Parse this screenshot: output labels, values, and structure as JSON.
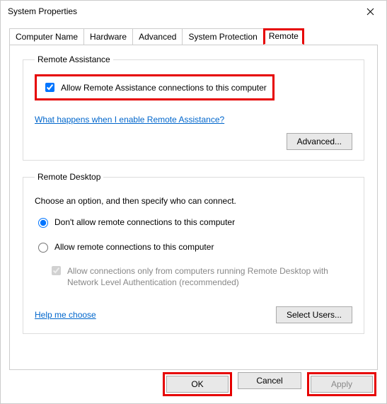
{
  "window": {
    "title": "System Properties"
  },
  "tabs": {
    "computer_name": "Computer Name",
    "hardware": "Hardware",
    "advanced": "Advanced",
    "system_protection": "System Protection",
    "remote": "Remote"
  },
  "remote_assistance": {
    "legend": "Remote Assistance",
    "allow_label": "Allow Remote Assistance connections to this computer",
    "allow_checked": true,
    "help_link": "What happens when I enable Remote Assistance?",
    "advanced_button": "Advanced..."
  },
  "remote_desktop": {
    "legend": "Remote Desktop",
    "instruction": "Choose an option, and then specify who can connect.",
    "option_deny": "Don't allow remote connections to this computer",
    "option_allow": "Allow remote connections to this computer",
    "selected": "deny",
    "nla_label": "Allow connections only from computers running Remote Desktop with Network Level Authentication (recommended)",
    "nla_checked": true,
    "help_link": "Help me choose",
    "select_users_button": "Select Users..."
  },
  "dialog_buttons": {
    "ok": "OK",
    "cancel": "Cancel",
    "apply": "Apply"
  }
}
